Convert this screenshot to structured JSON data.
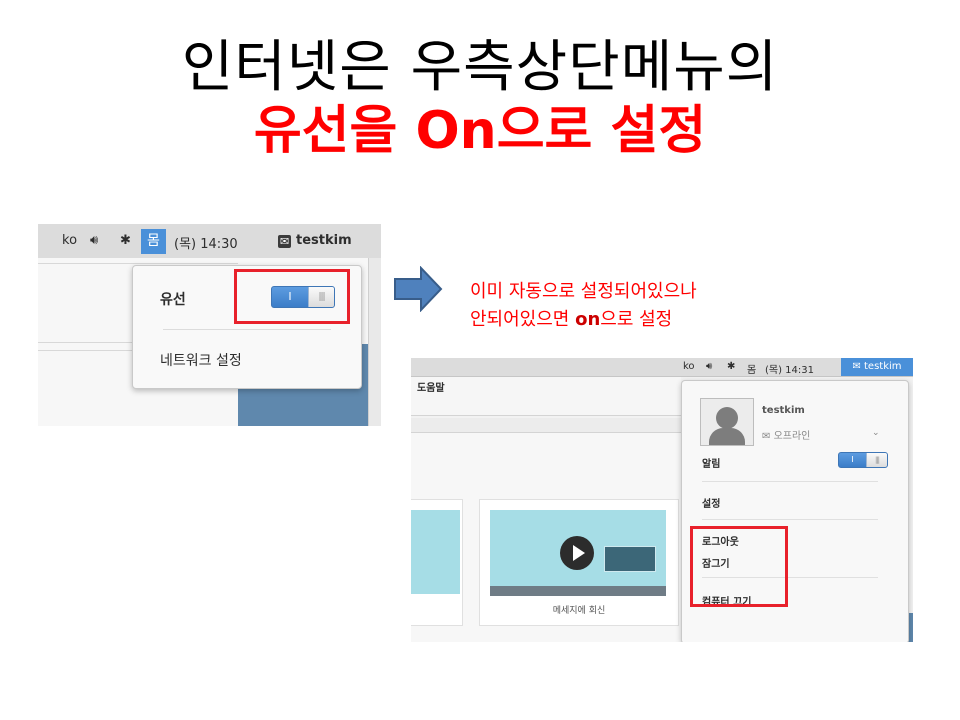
{
  "slide": {
    "title_line1": "인터넷은 우측상단메뉴의",
    "title_line2": "유선을 On으로 설정",
    "note_line1": "이미 자동으로 설정되어있으나",
    "note_line2_prefix": "안되어있으면 ",
    "note_line2_on": "on",
    "note_line2_suffix": "으로 설정"
  },
  "shot1": {
    "topbar": {
      "lang": "ko",
      "net_icon": "몸",
      "datetime": "(목) 14:30",
      "user": "testkim"
    },
    "popup": {
      "wired_label": "유선",
      "toggle_on_text": "I",
      "toggle_state": "on",
      "network_settings": "네트워크 설정"
    }
  },
  "shot2": {
    "topbar": {
      "lang": "ko",
      "net_icon": "몸",
      "datetime": "(목) 14:31",
      "user": "testkim"
    },
    "help_label": "도움말",
    "video_caption": "메세지에 회신",
    "menu": {
      "username": "testkim",
      "status": "오프라인",
      "notifications": "알림",
      "notifications_toggle_text": "I",
      "settings": "설정",
      "logout": "로그아웃",
      "lock": "잠그기",
      "power_off": "컴퓨터 끄기"
    }
  },
  "colors": {
    "accent_blue": "#4a90d9",
    "highlight_red": "#e8212b",
    "title_red": "#ff0000",
    "arrow_blue": "#4f81bd"
  }
}
